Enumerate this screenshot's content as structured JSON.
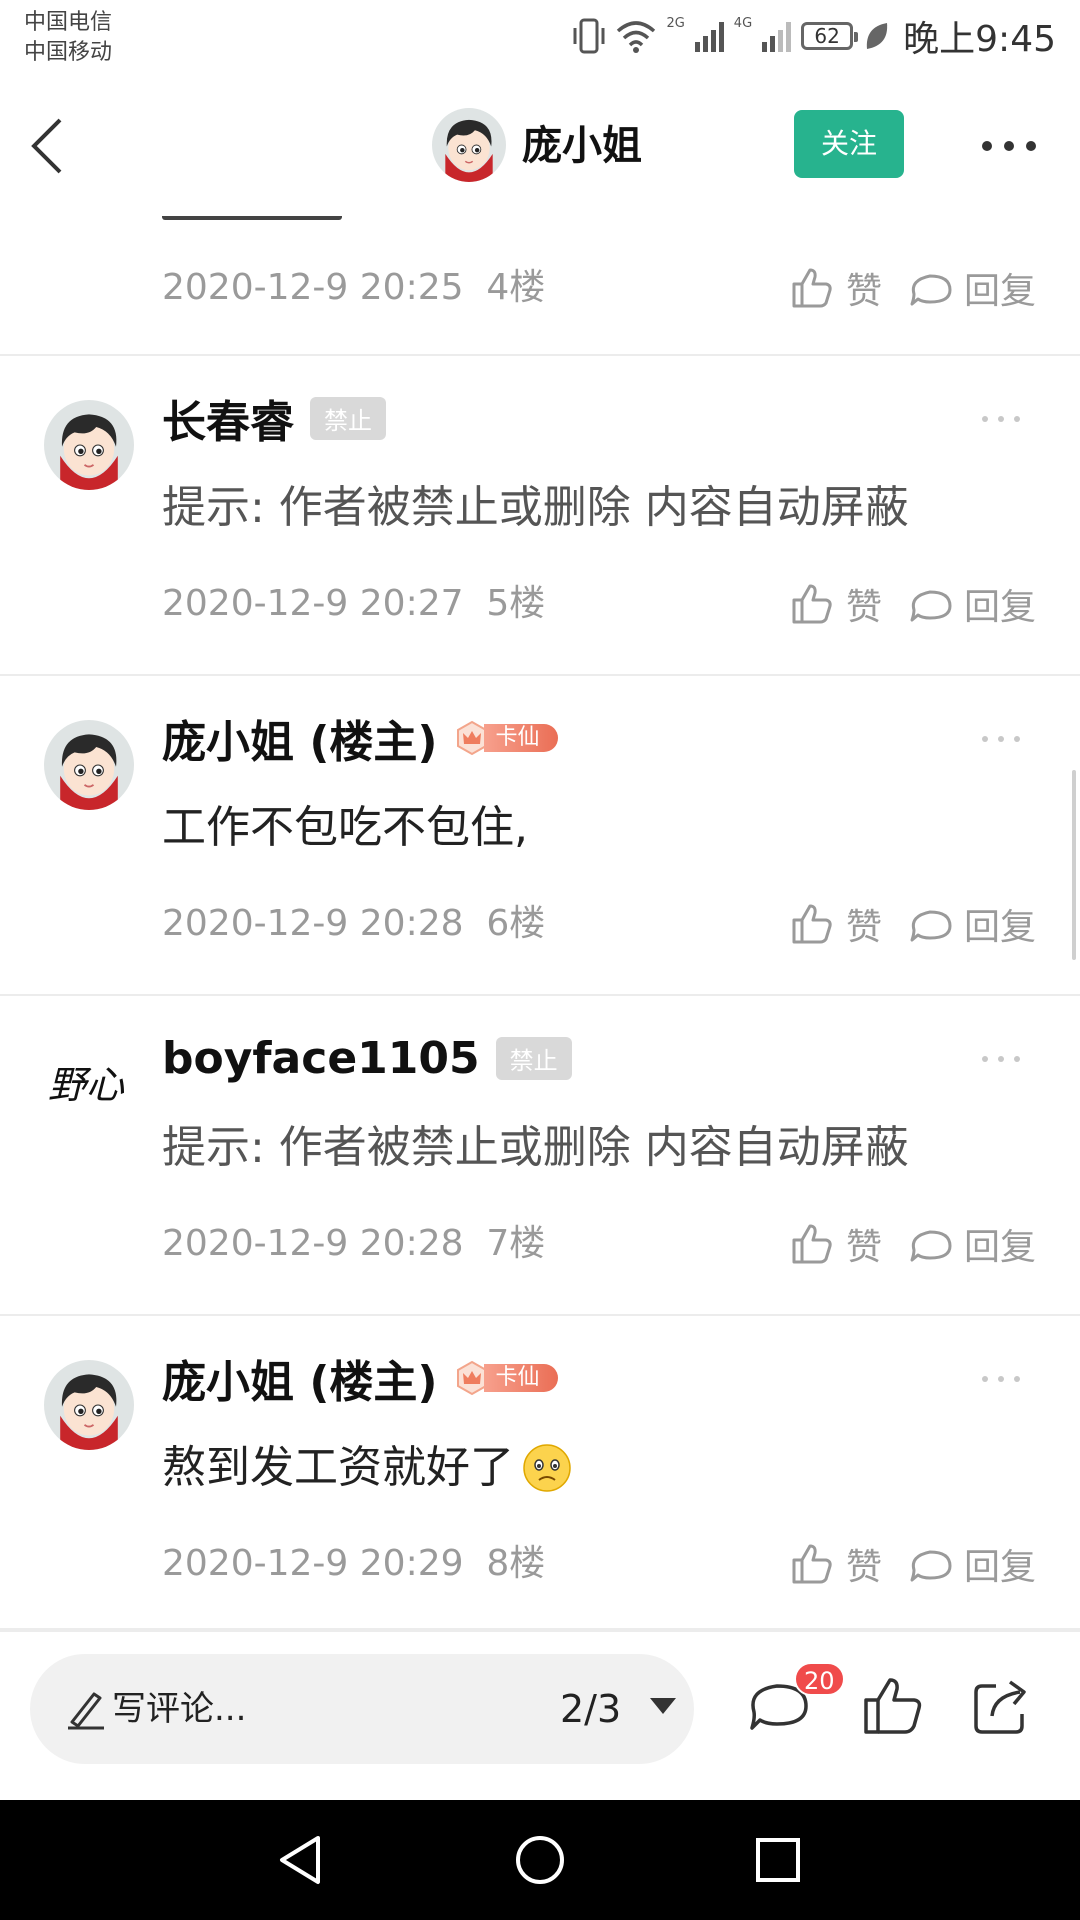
{
  "status_bar": {
    "carrier1": "中国电信",
    "carrier2": "中国移动",
    "net_2g": "2G",
    "net_4g": "4G",
    "battery": "62",
    "time": "晚上9:45"
  },
  "header": {
    "name": "庞小姐",
    "follow_label": "关注",
    "accent_color": "#27b38e"
  },
  "partial_post": {
    "meta": "2020-12-9 20:25  4楼",
    "like_label": "赞",
    "reply_label": "回复"
  },
  "posts": [
    {
      "username": "长春睿",
      "badge": "禁止",
      "content": "提示: 作者被禁止或删除 内容自动屏蔽",
      "meta": "2020-12-9 20:27  5楼",
      "like_label": "赞",
      "reply_label": "回复"
    },
    {
      "username": "庞小姐 (楼主)",
      "badge": "卡仙",
      "content": "工作不包吃不包住,",
      "meta": "2020-12-9 20:28  6楼",
      "like_label": "赞",
      "reply_label": "回复"
    },
    {
      "username": "boyface1105",
      "badge": "禁止",
      "content": "提示: 作者被禁止或删除 内容自动屏蔽",
      "meta": "2020-12-9 20:28  7楼",
      "like_label": "赞",
      "reply_label": "回复",
      "avatar_text": "野心"
    },
    {
      "username": "庞小姐 (楼主)",
      "badge": "卡仙",
      "content": "熬到发工资就好了",
      "meta": "2020-12-9 20:29  8楼",
      "like_label": "赞",
      "reply_label": "回复"
    }
  ],
  "bottom_bar": {
    "comment_placeholder": "写评论...",
    "page_indicator": "2/3",
    "comment_count": "20"
  }
}
